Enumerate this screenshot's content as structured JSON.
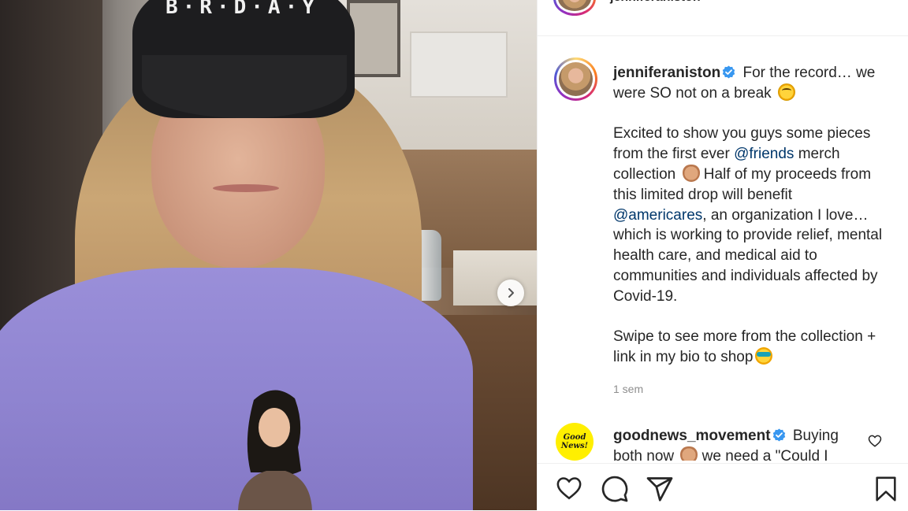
{
  "header": {
    "username_cut": "jenniferaniston"
  },
  "post": {
    "username": "jenniferaniston",
    "caption_line1": " For the record… we were SO not on a break ",
    "caption_p2_a": "Excited to show you guys some pieces from the first ever ",
    "mention_friends": "@friends",
    "caption_p2_b": " merch collection ",
    "caption_p2_c": " Half of my proceeds from this limited drop will benefit ",
    "mention_americares": "@americares",
    "caption_p2_d": ", an organization I love… which is working to provide relief, mental health care, and medical aid to communities and individuals affected by Covid-19.",
    "caption_p3": "Swipe to see more from the collection + link in my bio to shop",
    "timestamp": "1 sem",
    "cap_text": "B·R·D·A·Y"
  },
  "comment": {
    "username": "goodnews_movement",
    "text": " Buying both now ",
    "text_b": " we need a \"Could I",
    "avatar_text": "Good News!"
  },
  "icons": {
    "verified": "verified-badge-icon",
    "next": "chevron-right-icon",
    "like": "heart-icon",
    "comment": "comment-bubble-icon",
    "share": "paper-plane-icon",
    "save": "bookmark-icon"
  },
  "colors": {
    "mention": "#00376b",
    "verified": "#3897f0",
    "muted": "#8e8e8e",
    "text": "#262626"
  }
}
